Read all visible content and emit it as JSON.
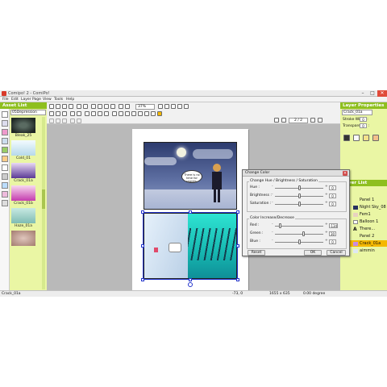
{
  "window": {
    "title": "Comipo! 2 - ComiPo!",
    "min": "–",
    "max": "□",
    "close": "✕"
  },
  "menu": [
    "File",
    "Edit",
    "Layer",
    "Page",
    "View",
    "Tools",
    "Help"
  ],
  "asset_panel": {
    "title": "Asset List",
    "dropdown": "05Depression",
    "items": [
      {
        "label": "Bleak_25",
        "color": "#2f3a36"
      },
      {
        "label": "Cold_01",
        "color": "#cfe7f2"
      },
      {
        "label": "Crack_01a",
        "color": "#a98ad6"
      },
      {
        "label": "Crack_01b",
        "color": "#d86cc8"
      },
      {
        "label": "Haze_01a",
        "color": "#9fd0c8"
      },
      {
        "label": "",
        "color": "#c6a49a"
      }
    ]
  },
  "toolbar": {
    "zoom": "37%"
  },
  "page_nav": {
    "current": "2 / 2"
  },
  "comic": {
    "speech_bubble": "There is no time for regrets."
  },
  "layer_properties": {
    "title": "Layer Properties",
    "layer_name": "Crack_01a",
    "stroke_width_label": "Stroke Width :",
    "stroke_width": "0",
    "transparency_label": "Transparency :",
    "transparency": "0"
  },
  "layer_list": {
    "title": "Layer List",
    "items": [
      {
        "label": "Panel 1",
        "selected": false
      },
      {
        "label": "Night Sky_08",
        "selected": false
      },
      {
        "label": "Fem1",
        "selected": false
      },
      {
        "label": "Balloon 1",
        "selected": false
      },
      {
        "label": "There...",
        "selected": false
      },
      {
        "label": "Panel 2",
        "selected": false
      },
      {
        "label": "Crack_01a",
        "selected": true
      },
      {
        "label": "aimmin",
        "selected": false
      }
    ]
  },
  "dialog": {
    "title": "Change Color",
    "hue_group": "Change Hue / Brightness / Saturation",
    "color_group": "Color Increase/Decrease",
    "sliders": [
      {
        "label": "Hue :",
        "value": "0"
      },
      {
        "label": "Brightness :",
        "value": "0"
      },
      {
        "label": "Saturation :",
        "value": "0"
      },
      {
        "label": "Red :",
        "value": "-134"
      },
      {
        "label": "Green :",
        "value": "30"
      },
      {
        "label": "Blue :",
        "value": "0"
      }
    ],
    "reset": "Reset",
    "ok": "OK",
    "cancel": "Cancel"
  },
  "status": {
    "layer": "Crack_01a",
    "coords": "-73, 0",
    "size": "1655 x 635",
    "angle": "0.00 degree"
  },
  "colors": {
    "accent": "#8ebf1f",
    "panel_bg": "#eaf6a4",
    "selection": "#f5b800"
  }
}
